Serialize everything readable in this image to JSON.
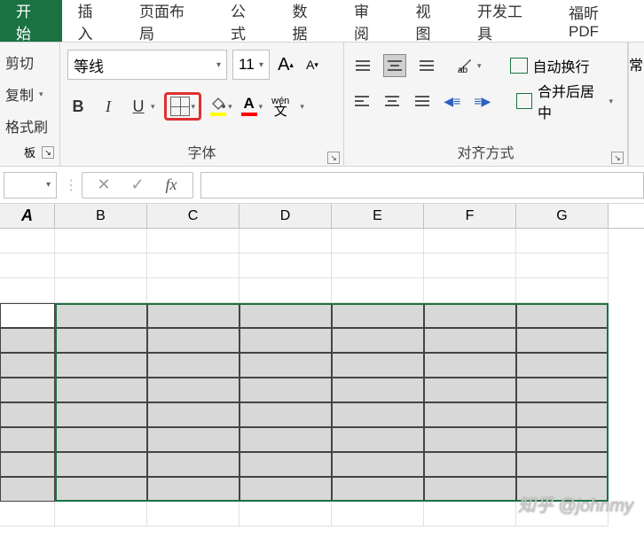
{
  "tabs": {
    "start": "开始",
    "insert": "插入",
    "page_layout": "页面布局",
    "formula": "公式",
    "data": "数据",
    "review": "审阅",
    "view": "视图",
    "dev": "开发工具",
    "foxit": "福昕PDF"
  },
  "clipboard": {
    "cut": "剪切",
    "copy": "复制",
    "format_brush": "格式刷",
    "group_label": "板"
  },
  "font": {
    "name": "等线",
    "size": "11",
    "grow_label": "A",
    "shrink_label": "A",
    "bold": "B",
    "italic": "I",
    "underline": "U",
    "wen_top": "wén",
    "wen_bottom": "文",
    "group_label": "字体"
  },
  "align": {
    "wrap": "自动换行",
    "merge": "合并后居中",
    "group_label": "对齐方式"
  },
  "right_edge": "常",
  "grid": {
    "columns": [
      "A",
      "B",
      "C",
      "D",
      "E",
      "F",
      "G"
    ]
  },
  "watermark": "知乎 @johnmy"
}
